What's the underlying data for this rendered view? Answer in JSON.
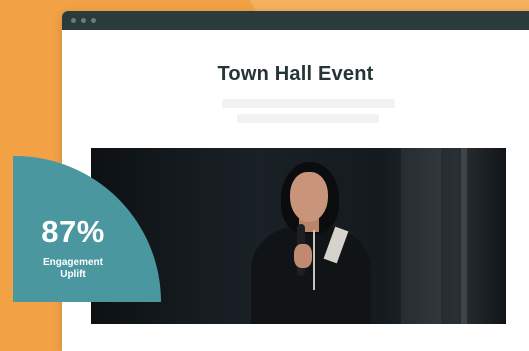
{
  "window": {
    "title": "Town Hall Event"
  },
  "stat_badge": {
    "value": "87%",
    "label_line1": "Engagement",
    "label_line2": "Uplift"
  },
  "colors": {
    "background": "#f2a245",
    "titlebar": "#2b3a3b",
    "badge": "#4a97a0",
    "title_text": "#253434"
  },
  "icons": [
    "window-dot-icon",
    "window-dot-icon",
    "window-dot-icon"
  ]
}
